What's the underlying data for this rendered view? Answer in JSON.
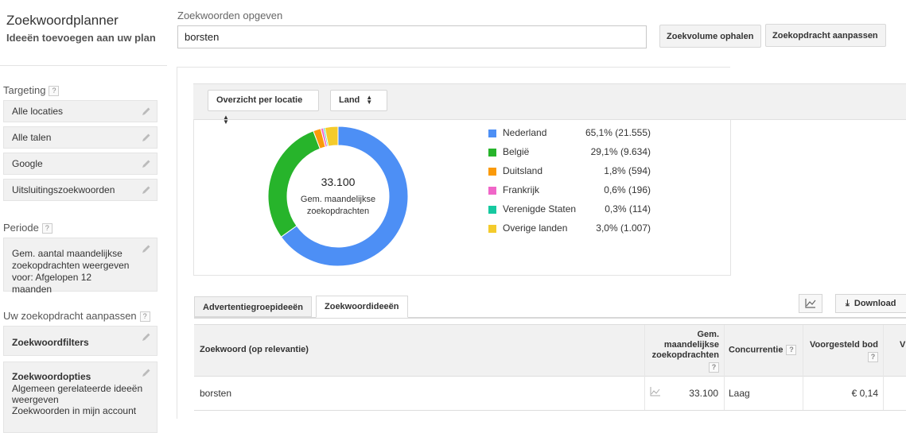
{
  "header": {
    "title": "Zoekwoordplanner",
    "subtitle": "Ideeën toevoegen aan uw plan",
    "keywords_label": "Zoekwoorden opgeven",
    "keywords_value": "borsten",
    "get_volume_button": "Zoekvolume ophalen",
    "modify_search_button": "Zoekopdracht aanpassen"
  },
  "sidebar": {
    "targeting_heading": "Targeting",
    "targeting_items": [
      "Alle locaties",
      "Alle talen",
      "Google",
      "Uitsluitingszoekwoorden"
    ],
    "period_heading": "Periode",
    "period_text": "Gem. aantal maandelijkse zoekopdrachten weergeven voor: Afgelopen 12 maanden",
    "customize_heading": "Uw zoekopdracht aanpassen",
    "filters_label": "Zoekwoordfilters",
    "options_label": "Zoekwoordopties",
    "options_line1": "Algemeen gerelateerde ideeën weergeven",
    "options_line2": "Zoekwoorden in mijn account"
  },
  "overview": {
    "breakdown_select": "Overzicht per locatie",
    "level_select": "Land"
  },
  "chart_data": {
    "type": "pie",
    "center_value": "33.100",
    "center_label": "Gem. maandelijkse zoekopdrachten",
    "categories": [
      "Nederland",
      "België",
      "Duitsland",
      "Frankrijk",
      "Verenigde Staten",
      "Overige landen"
    ],
    "values": [
      21555,
      9634,
      594,
      196,
      114,
      1007
    ],
    "labels": [
      "65,1% (21.555)",
      "29,1% (9.634)",
      "1,8% (594)",
      "0,6% (196)",
      "0,3% (114)",
      "3,0% (1.007)"
    ],
    "colors": [
      "#4d8ff5",
      "#27b42b",
      "#fa9a0a",
      "#f066c8",
      "#16c9a0",
      "#f4cb2c"
    ]
  },
  "tabs": {
    "ad_group_ideas": "Advertentiegroepideeën",
    "keyword_ideas": "Zoekwoordideeën",
    "download": "Download"
  },
  "table": {
    "headers": {
      "keyword": "Zoekwoord (op relevantie)",
      "avg_searches": "Gem. maandelijkse zoekopdrachten",
      "competition": "Concurrentie",
      "suggested_bid": "Voorgesteld bod",
      "next_col_initial": "V"
    },
    "rows": [
      {
        "keyword": "borsten",
        "avg_searches": "33.100",
        "competition": "Laag",
        "suggested_bid": "€ 0,14"
      }
    ]
  }
}
